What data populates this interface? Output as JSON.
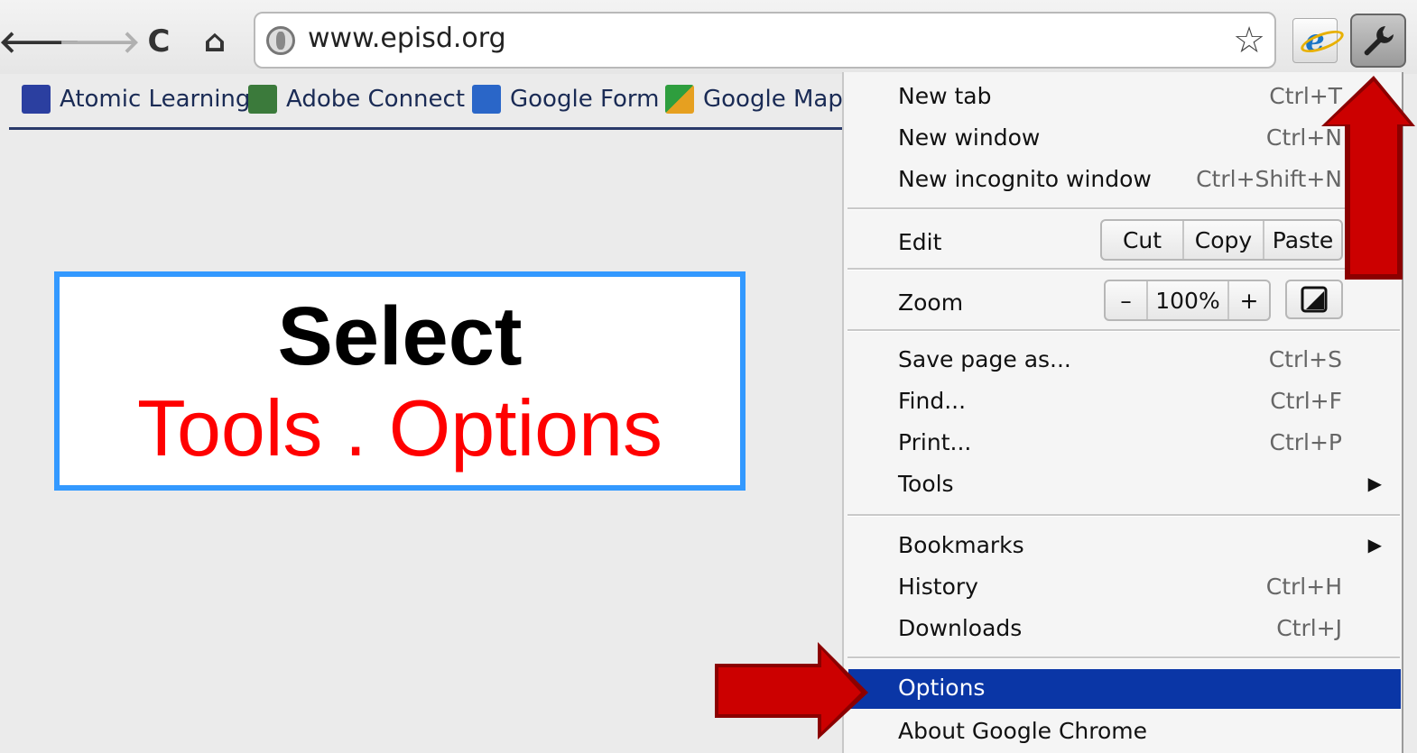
{
  "toolbar": {
    "back_glyph": "🡐",
    "forward_glyph": "🡒",
    "reload_glyph": "C",
    "home_glyph": "⌂",
    "url": "www.episd.org",
    "star_glyph": "☆",
    "ie_glyph": "e"
  },
  "bookmarks": [
    {
      "label": "Atomic Learning",
      "icon": "atomic-learning-icon",
      "color": "#2b3fa0"
    },
    {
      "label": "Adobe Connect",
      "icon": "adobe-connect-icon",
      "color": "#3b7a3b"
    },
    {
      "label": "Google Form",
      "icon": "google-form-icon",
      "color": "#2a66c8"
    },
    {
      "label": "Google Maps",
      "icon": "google-maps-icon",
      "color": "#2e9e3e"
    }
  ],
  "callout": {
    "line1": "Select",
    "line2": "Tools .  Options"
  },
  "menu": {
    "new_tab": {
      "label": "New tab",
      "shortcut": "Ctrl+T"
    },
    "new_window": {
      "label": "New window",
      "shortcut": "Ctrl+N"
    },
    "new_incognito": {
      "label": "New incognito window",
      "shortcut": "Ctrl+Shift+N"
    },
    "edit": {
      "label": "Edit",
      "cut": "Cut",
      "copy": "Copy",
      "paste": "Paste"
    },
    "zoom": {
      "label": "Zoom",
      "minus": "–",
      "value": "100%",
      "plus": "+"
    },
    "save_page": {
      "label": "Save page as...",
      "shortcut": "Ctrl+S"
    },
    "find": {
      "label": "Find...",
      "shortcut": "Ctrl+F"
    },
    "print": {
      "label": "Print...",
      "shortcut": "Ctrl+P"
    },
    "tools": {
      "label": "Tools",
      "submenu_glyph": "▶"
    },
    "bookmarks": {
      "label": "Bookmarks",
      "submenu_glyph": "▶"
    },
    "history": {
      "label": "History",
      "shortcut": "Ctrl+H"
    },
    "downloads": {
      "label": "Downloads",
      "shortcut": "Ctrl+J"
    },
    "options": {
      "label": "Options"
    },
    "about": {
      "label": "About Google Chrome"
    }
  },
  "colors": {
    "highlight": "#0a36a6",
    "arrow": "#c00000",
    "callout_border": "#3399ff",
    "callout_accent": "#ff0000"
  }
}
